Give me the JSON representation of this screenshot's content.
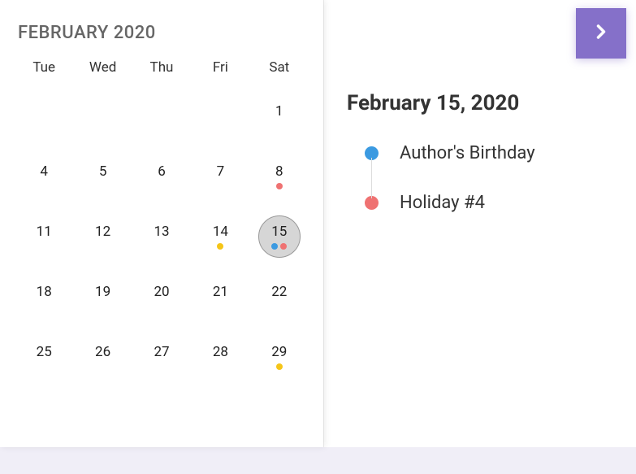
{
  "calendar": {
    "month_title": "FEBRUARY 2020",
    "weekdays": [
      "Tue",
      "Wed",
      "Thu",
      "Fri",
      "Sat"
    ],
    "weeks": [
      [
        null,
        null,
        null,
        null,
        {
          "n": 1,
          "dots": []
        }
      ],
      [
        {
          "n": 4,
          "dots": []
        },
        {
          "n": 5,
          "dots": []
        },
        {
          "n": 6,
          "dots": []
        },
        {
          "n": 7,
          "dots": []
        },
        {
          "n": 8,
          "dots": [
            "pink"
          ]
        }
      ],
      [
        {
          "n": 11,
          "dots": []
        },
        {
          "n": 12,
          "dots": []
        },
        {
          "n": 13,
          "dots": []
        },
        {
          "n": 14,
          "dots": [
            "yellow"
          ]
        },
        {
          "n": 15,
          "dots": [
            "blue",
            "pink"
          ],
          "selected": true
        }
      ],
      [
        {
          "n": 18,
          "dots": []
        },
        {
          "n": 19,
          "dots": []
        },
        {
          "n": 20,
          "dots": []
        },
        {
          "n": 21,
          "dots": []
        },
        {
          "n": 22,
          "dots": []
        }
      ],
      [
        {
          "n": 25,
          "dots": []
        },
        {
          "n": 26,
          "dots": []
        },
        {
          "n": 27,
          "dots": []
        },
        {
          "n": 28,
          "dots": []
        },
        {
          "n": 29,
          "dots": [
            "yellow"
          ]
        }
      ]
    ]
  },
  "detail": {
    "date_label": "February 15, 2020",
    "events": [
      {
        "color": "blue",
        "title": "Author's Birthday"
      },
      {
        "color": "pink",
        "title": "Holiday #4"
      }
    ]
  }
}
